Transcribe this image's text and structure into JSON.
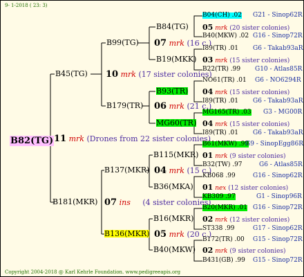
{
  "header": {
    "date": "9-  1-2018 ( 23:  3)"
  },
  "footer": {
    "text": "Copyright 2004-2018 @ Karl Kehrle Foundation.   www.pedigreeapis.org"
  },
  "root": {
    "id": "B82(TG)",
    "count": "11",
    "label": "mrk",
    "note": "(Drones from 22 sister colonies)"
  },
  "gen1": [
    {
      "id": "B45(TG)",
      "count": "10",
      "label": "mrk",
      "note": "(17 sister colonies)"
    },
    {
      "id": "B181(MKR)",
      "count": "07",
      "label": "ins",
      "note": "(4 sister colonies)"
    }
  ],
  "gen2": [
    {
      "id": "B99(TG)",
      "count": "07",
      "label": "mrk",
      "note": "(16 c.)"
    },
    {
      "id": "B179(TR)",
      "count": "06",
      "label": "mrk",
      "note": "(21 c.)"
    },
    {
      "id": "B137(MKR)",
      "count": "04",
      "label": "mrk",
      "note": "(15 c.)"
    },
    {
      "id": "B136(MKR)",
      "count": "05",
      "label": "mrk",
      "note": "(20 c.)"
    }
  ],
  "gen3": [
    {
      "id": "B84(TG)",
      "count": "05",
      "label": "mrk",
      "note": "(20 sister colonies)"
    },
    {
      "id": "B19(MKK)",
      "count": "03",
      "label": "mrk",
      "note": "(15 sister colonies)"
    },
    {
      "id": "B93(TR)",
      "count": "04",
      "label": "mrk",
      "note": "(15 sister colonies)"
    },
    {
      "id": "MG60(TR)",
      "count": "04",
      "label": "mrk",
      "note": "(15 sister colonies)"
    },
    {
      "id": "B115(MKR)",
      "count": "01",
      "label": "mrk",
      "note": "(9 sister colonies)"
    },
    {
      "id": "B36(MKA)",
      "count": "01",
      "label": "nex",
      "note": "(12 sister colonies)"
    },
    {
      "id": "B16(MKR)",
      "count": "02",
      "label": "mrk",
      "note": "(12 sister colonies)"
    },
    {
      "id": "B40(MKW)",
      "count": "02",
      "label": "mrk",
      "note": "(9 sister colonies)"
    }
  ],
  "gen4": [
    {
      "left": "B04(CH) .02",
      "right": "G21 - Sinop62R"
    },
    {
      "left": "B40(MKW) .02",
      "right": "G16 - Sinop72R"
    },
    {
      "left": "I89(TR) .01",
      "right": "G6 - Takab93aR"
    },
    {
      "left": "B22(TR) .99",
      "right": "G10 - Atlas85R"
    },
    {
      "left": "NO61(TR) .01",
      "right": "G6 - NO6294R"
    },
    {
      "left": "I89(TR) .01",
      "right": "G6 - Takab93aR"
    },
    {
      "left": "MG165(TR) .03",
      "right": "G3 - MG00R"
    },
    {
      "left": "I89(TR) .01",
      "right": "G6 - Takab93aR"
    },
    {
      "left": "B61(MKW) .99",
      "right": "G9 - SinopEgg86R"
    },
    {
      "left": "B32(TW) .97",
      "right": "G6 - Atlas85R"
    },
    {
      "left": "KB068 .99",
      "right": "G16 - Sinop62R"
    },
    {
      "left": "KB309 .97",
      "right": "G1 - Sinop96R"
    },
    {
      "left": "B20(MKR) .01",
      "right": "G16 - Sinop72R"
    },
    {
      "left": "ST338 .99",
      "right": "G17 - Sinop62R"
    },
    {
      "left": "B172(TR) .00",
      "right": "G15 - Sinop72R"
    },
    {
      "left": "B431(GB) .99",
      "right": "G15 - Sinop72R"
    }
  ],
  "colors": {
    "green": "#00ee00",
    "cyan": "#00ffff",
    "yellow": "#ffff00",
    "root": "#ffc0ff",
    "red": "#d00000"
  }
}
